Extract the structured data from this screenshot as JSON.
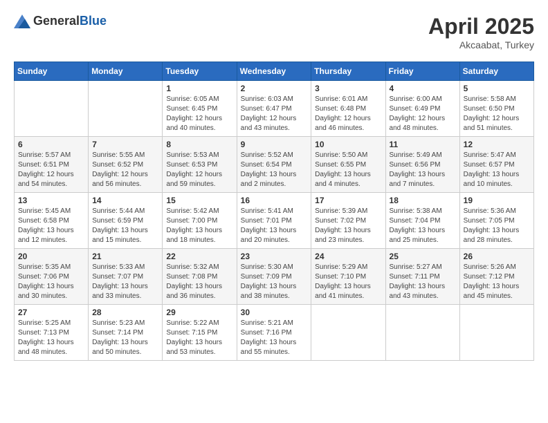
{
  "header": {
    "logo_general": "General",
    "logo_blue": "Blue",
    "month_year": "April 2025",
    "location": "Akcaabat, Turkey"
  },
  "calendar": {
    "days_of_week": [
      "Sunday",
      "Monday",
      "Tuesday",
      "Wednesday",
      "Thursday",
      "Friday",
      "Saturday"
    ],
    "weeks": [
      [
        {
          "day": "",
          "info": ""
        },
        {
          "day": "",
          "info": ""
        },
        {
          "day": "1",
          "info": "Sunrise: 6:05 AM\nSunset: 6:45 PM\nDaylight: 12 hours and 40 minutes."
        },
        {
          "day": "2",
          "info": "Sunrise: 6:03 AM\nSunset: 6:47 PM\nDaylight: 12 hours and 43 minutes."
        },
        {
          "day": "3",
          "info": "Sunrise: 6:01 AM\nSunset: 6:48 PM\nDaylight: 12 hours and 46 minutes."
        },
        {
          "day": "4",
          "info": "Sunrise: 6:00 AM\nSunset: 6:49 PM\nDaylight: 12 hours and 48 minutes."
        },
        {
          "day": "5",
          "info": "Sunrise: 5:58 AM\nSunset: 6:50 PM\nDaylight: 12 hours and 51 minutes."
        }
      ],
      [
        {
          "day": "6",
          "info": "Sunrise: 5:57 AM\nSunset: 6:51 PM\nDaylight: 12 hours and 54 minutes."
        },
        {
          "day": "7",
          "info": "Sunrise: 5:55 AM\nSunset: 6:52 PM\nDaylight: 12 hours and 56 minutes."
        },
        {
          "day": "8",
          "info": "Sunrise: 5:53 AM\nSunset: 6:53 PM\nDaylight: 12 hours and 59 minutes."
        },
        {
          "day": "9",
          "info": "Sunrise: 5:52 AM\nSunset: 6:54 PM\nDaylight: 13 hours and 2 minutes."
        },
        {
          "day": "10",
          "info": "Sunrise: 5:50 AM\nSunset: 6:55 PM\nDaylight: 13 hours and 4 minutes."
        },
        {
          "day": "11",
          "info": "Sunrise: 5:49 AM\nSunset: 6:56 PM\nDaylight: 13 hours and 7 minutes."
        },
        {
          "day": "12",
          "info": "Sunrise: 5:47 AM\nSunset: 6:57 PM\nDaylight: 13 hours and 10 minutes."
        }
      ],
      [
        {
          "day": "13",
          "info": "Sunrise: 5:45 AM\nSunset: 6:58 PM\nDaylight: 13 hours and 12 minutes."
        },
        {
          "day": "14",
          "info": "Sunrise: 5:44 AM\nSunset: 6:59 PM\nDaylight: 13 hours and 15 minutes."
        },
        {
          "day": "15",
          "info": "Sunrise: 5:42 AM\nSunset: 7:00 PM\nDaylight: 13 hours and 18 minutes."
        },
        {
          "day": "16",
          "info": "Sunrise: 5:41 AM\nSunset: 7:01 PM\nDaylight: 13 hours and 20 minutes."
        },
        {
          "day": "17",
          "info": "Sunrise: 5:39 AM\nSunset: 7:02 PM\nDaylight: 13 hours and 23 minutes."
        },
        {
          "day": "18",
          "info": "Sunrise: 5:38 AM\nSunset: 7:04 PM\nDaylight: 13 hours and 25 minutes."
        },
        {
          "day": "19",
          "info": "Sunrise: 5:36 AM\nSunset: 7:05 PM\nDaylight: 13 hours and 28 minutes."
        }
      ],
      [
        {
          "day": "20",
          "info": "Sunrise: 5:35 AM\nSunset: 7:06 PM\nDaylight: 13 hours and 30 minutes."
        },
        {
          "day": "21",
          "info": "Sunrise: 5:33 AM\nSunset: 7:07 PM\nDaylight: 13 hours and 33 minutes."
        },
        {
          "day": "22",
          "info": "Sunrise: 5:32 AM\nSunset: 7:08 PM\nDaylight: 13 hours and 36 minutes."
        },
        {
          "day": "23",
          "info": "Sunrise: 5:30 AM\nSunset: 7:09 PM\nDaylight: 13 hours and 38 minutes."
        },
        {
          "day": "24",
          "info": "Sunrise: 5:29 AM\nSunset: 7:10 PM\nDaylight: 13 hours and 41 minutes."
        },
        {
          "day": "25",
          "info": "Sunrise: 5:27 AM\nSunset: 7:11 PM\nDaylight: 13 hours and 43 minutes."
        },
        {
          "day": "26",
          "info": "Sunrise: 5:26 AM\nSunset: 7:12 PM\nDaylight: 13 hours and 45 minutes."
        }
      ],
      [
        {
          "day": "27",
          "info": "Sunrise: 5:25 AM\nSunset: 7:13 PM\nDaylight: 13 hours and 48 minutes."
        },
        {
          "day": "28",
          "info": "Sunrise: 5:23 AM\nSunset: 7:14 PM\nDaylight: 13 hours and 50 minutes."
        },
        {
          "day": "29",
          "info": "Sunrise: 5:22 AM\nSunset: 7:15 PM\nDaylight: 13 hours and 53 minutes."
        },
        {
          "day": "30",
          "info": "Sunrise: 5:21 AM\nSunset: 7:16 PM\nDaylight: 13 hours and 55 minutes."
        },
        {
          "day": "",
          "info": ""
        },
        {
          "day": "",
          "info": ""
        },
        {
          "day": "",
          "info": ""
        }
      ]
    ]
  }
}
